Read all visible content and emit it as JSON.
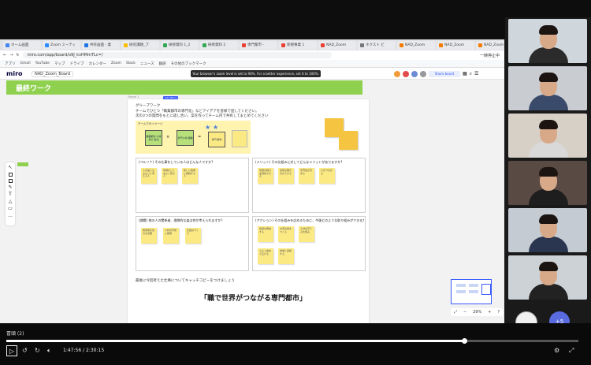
{
  "browser": {
    "tabs": [
      {
        "label": "ホーム画面",
        "color": "#4285f4"
      },
      {
        "label": "Zoom ミーティ",
        "color": "#2d8cff"
      },
      {
        "label": "共有画面 - 業",
        "color": "#1a73e8"
      },
      {
        "label": "研究課題_プ",
        "color": "#fbbc04"
      },
      {
        "label": "研修資料 1_2",
        "color": "#34a853"
      },
      {
        "label": "研修資料 2",
        "color": "#34a853"
      },
      {
        "label": "専門都市 -",
        "color": "#ea4335"
      },
      {
        "label": "新規事業 1",
        "color": "#ea4335"
      },
      {
        "label": "NAD_Zoom",
        "color": "#ea4335"
      },
      {
        "label": "ネクスト ビ",
        "color": "#777777"
      },
      {
        "label": "NAD_Zoom",
        "color": "#f57c00"
      },
      {
        "label": "NAD_Zoom",
        "color": "#f57c00"
      },
      {
        "label": "NAD_Zoom",
        "color": "#f57c00"
      }
    ],
    "url": "miro.com/app/board/o9J_kvHMmTLc=/",
    "bookmarks": [
      "アプリ",
      "Gmail",
      "YouTube",
      "マップ",
      "ドライブ",
      "カレンダー",
      "Zoom",
      "Slack",
      "ニュース",
      "翻訳",
      "その他のブックマーク"
    ],
    "menu_label": "一時停止中"
  },
  "miro": {
    "logo": "miro",
    "board_name": "NAD_Zoom_Board",
    "banner": "Your browser's zoom level is set to 90%. For a better experience, set it to 100%.",
    "share_label": "Share board",
    "frame_title": "最終ワーク",
    "doc_label": "Frame 1",
    "cursor_label": "Yuki Miura",
    "group_work": "グループワーク",
    "instruction1": "チームでひとつ「職業都市の専門化」などアイデアを皆様で話してください。",
    "instruction2": "次の3つの質問をもとに話し合い、案を作ってチーム内で共有してまとめてください",
    "diagram": {
      "sticky1": "職業都市\nの将来の\n役割",
      "sticky2": "専門人材\n職種",
      "sticky3": "専門\n都市",
      "label": "チームでのイメージ"
    },
    "quadrants": [
      {
        "title": "(ペルソナ) その仕事をしている人はどんな人ですか?",
        "stickies": [
          "人の役に立ちたいと考える人",
          "地域のことをよく知る人",
          "新しい技術に挑戦する人"
        ]
      },
      {
        "title": "(メリット) その仕組みに対してどんなメリットがありますか?",
        "stickies": [
          "地域の魅力を発信できる",
          "多様な働き方ができる",
          "専門性が高まる",
          "人がつながる"
        ]
      },
      {
        "title": "(課題) 他の人の関係者、理想的な姿は何が考えられますか?",
        "stickies": [
          "関係者の協力が必要",
          "人材の育成と確保",
          "仕組みづくり"
        ]
      },
      {
        "title": "(アクション) その仕組みを広めるために、今後どのような取り組みができるか?",
        "stickies": [
          "情報を発信する",
          "交流の場をつくる",
          "人材を育てる仕組み",
          "小さく始めて広げる",
          "地域と連携する"
        ]
      }
    ],
    "reflection": "最後に今回考えた仕事についてキャッチコピーをつけましょう",
    "motto": "「職で世界がつながる専門都市」",
    "zoom_level": "29%"
  },
  "participants": [
    "participant-1",
    "participant-2",
    "participant-3",
    "participant-4",
    "participant-5",
    "participant-6"
  ],
  "extra_participants": "+5",
  "player": {
    "chapter": "冒頭 (2)",
    "time_current": "1:47:56",
    "time_total": "2:30:15",
    "progress_fraction": 0.8
  }
}
